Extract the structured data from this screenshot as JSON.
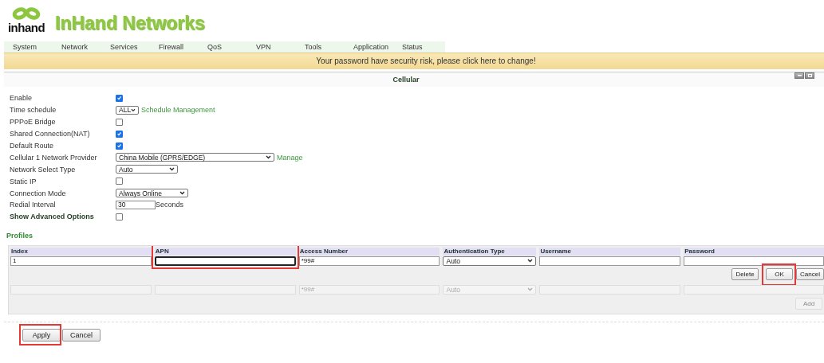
{
  "logo": {
    "wordmark": "inhand",
    "title": "InHand Networks"
  },
  "nav": [
    {
      "label": "System"
    },
    {
      "label": "Network"
    },
    {
      "label": "Services"
    },
    {
      "label": "Firewall"
    },
    {
      "label": "QoS"
    },
    {
      "label": "VPN"
    },
    {
      "label": "Tools"
    },
    {
      "label": "Application"
    },
    {
      "label": "Status"
    }
  ],
  "banner": "Your password have security risk, please click here to change!",
  "panel": {
    "title": "Cellular"
  },
  "settings": [
    {
      "label": "Enable",
      "kind": "checkbox",
      "checked": true
    },
    {
      "label": "Time schedule",
      "kind": "select",
      "value": "ALL",
      "link": "Schedule Management"
    },
    {
      "label": "PPPoE Bridge",
      "kind": "checkbox",
      "checked": false
    },
    {
      "label": "Shared Connection(NAT)",
      "kind": "checkbox",
      "checked": true
    },
    {
      "label": "Default Route",
      "kind": "checkbox",
      "checked": true
    },
    {
      "label": "Cellular 1 Network Provider",
      "kind": "select",
      "value": "China Mobile (GPRS/EDGE)",
      "link": "Manage"
    },
    {
      "label": "Network Select Type",
      "kind": "select",
      "value": "Auto"
    },
    {
      "label": "Static IP",
      "kind": "checkbox",
      "checked": false
    },
    {
      "label": "Connection Mode",
      "kind": "select",
      "value": "Always Online"
    },
    {
      "label": "Redial Interval",
      "kind": "text",
      "value": "30",
      "suffix": "Seconds"
    },
    {
      "label": "Show Advanced Options",
      "kind": "checkbox",
      "checked": false,
      "emphasis": true
    }
  ],
  "profiles": {
    "title": "Profiles",
    "columns": [
      {
        "label": "Index",
        "highlighted": false
      },
      {
        "label": "APN",
        "highlighted": true
      },
      {
        "label": "Access Number",
        "highlighted": false
      },
      {
        "label": "Authentication Type",
        "highlighted": false
      },
      {
        "label": "Username",
        "highlighted": false
      },
      {
        "label": "Password",
        "highlighted": false
      }
    ],
    "edit_row": [
      {
        "kind": "text",
        "value": "1",
        "focused": false
      },
      {
        "kind": "text",
        "focused": true
      },
      {
        "kind": "text",
        "value": "*99#",
        "focused": false
      },
      {
        "kind": "select",
        "value": "Auto",
        "focused": false
      },
      {
        "kind": "text",
        "focused": false
      },
      {
        "kind": "text",
        "focused": false
      }
    ],
    "row_buttons": [
      {
        "label": "Delete",
        "highlighted": false
      },
      {
        "label": "OK",
        "highlighted": true
      },
      {
        "label": "Cancel",
        "highlighted": false
      }
    ],
    "new_row": [
      {
        "kind": "text"
      },
      {
        "kind": "text"
      },
      {
        "kind": "text",
        "value": "*99#"
      },
      {
        "kind": "select",
        "value": "Auto"
      },
      {
        "kind": "text"
      },
      {
        "kind": "text"
      }
    ],
    "new_row_disabled": true,
    "add_button": {
      "label": "Add",
      "disabled": true
    }
  },
  "actions": [
    {
      "label": "Apply",
      "highlighted": true
    },
    {
      "label": "Cancel",
      "highlighted": false
    }
  ]
}
